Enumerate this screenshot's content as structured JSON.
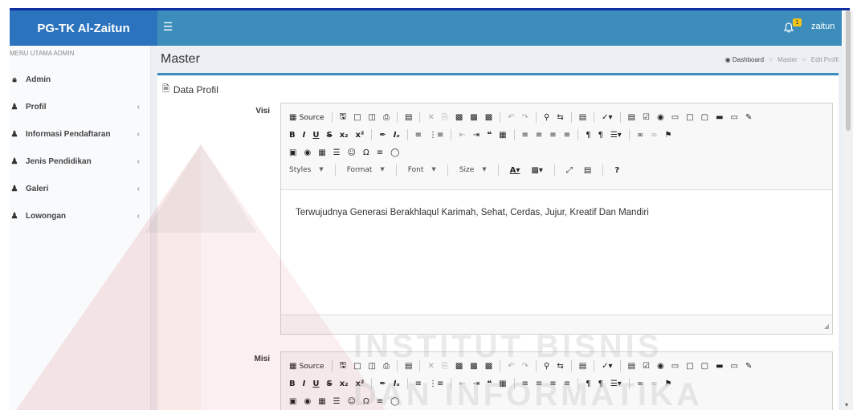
{
  "app": {
    "brand": "PG-TK Al-Zaitun",
    "menu_icon": "hamburger-icon"
  },
  "header": {
    "notification_count": "1",
    "username": "zaitun"
  },
  "sidebar": {
    "header": "MENU UTAMA ADMIN",
    "items": [
      {
        "label": "Admin",
        "icon": "lock-icon",
        "has_children": false
      },
      {
        "label": "Profil",
        "icon": "user-icon",
        "has_children": true
      },
      {
        "label": "Informasi Pendaftaran",
        "icon": "user-icon",
        "has_children": true
      },
      {
        "label": "Jenis Pendidikan",
        "icon": "user-icon",
        "has_children": true
      },
      {
        "label": "Galeri",
        "icon": "user-icon",
        "has_children": true
      },
      {
        "label": "Lowongan",
        "icon": "user-icon",
        "has_children": true
      }
    ]
  },
  "page": {
    "title": "Master",
    "breadcrumb": [
      "Dashboard",
      "Master",
      "Edit Profil"
    ]
  },
  "box": {
    "title": "Data Profil"
  },
  "editor": {
    "source_label": "Source",
    "styles_label": "Styles",
    "format_label": "Format",
    "font_label": "Font",
    "size_label": "Size"
  },
  "form": {
    "visi": {
      "label": "Visi",
      "value": "Terwujudnya Generasi Berakhlaqul Karimah, Sehat, Cerdas, Jujur, Kreatif Dan Mandiri"
    },
    "misi": {
      "label": "Misi"
    }
  },
  "watermark": {
    "line1": "INSTITUT BISNIS",
    "line2": "DAN INFORMATIKA"
  },
  "colors": {
    "brand": "#2c73bd",
    "navbar": "#3c8dbc",
    "badge": "#f0c419"
  }
}
